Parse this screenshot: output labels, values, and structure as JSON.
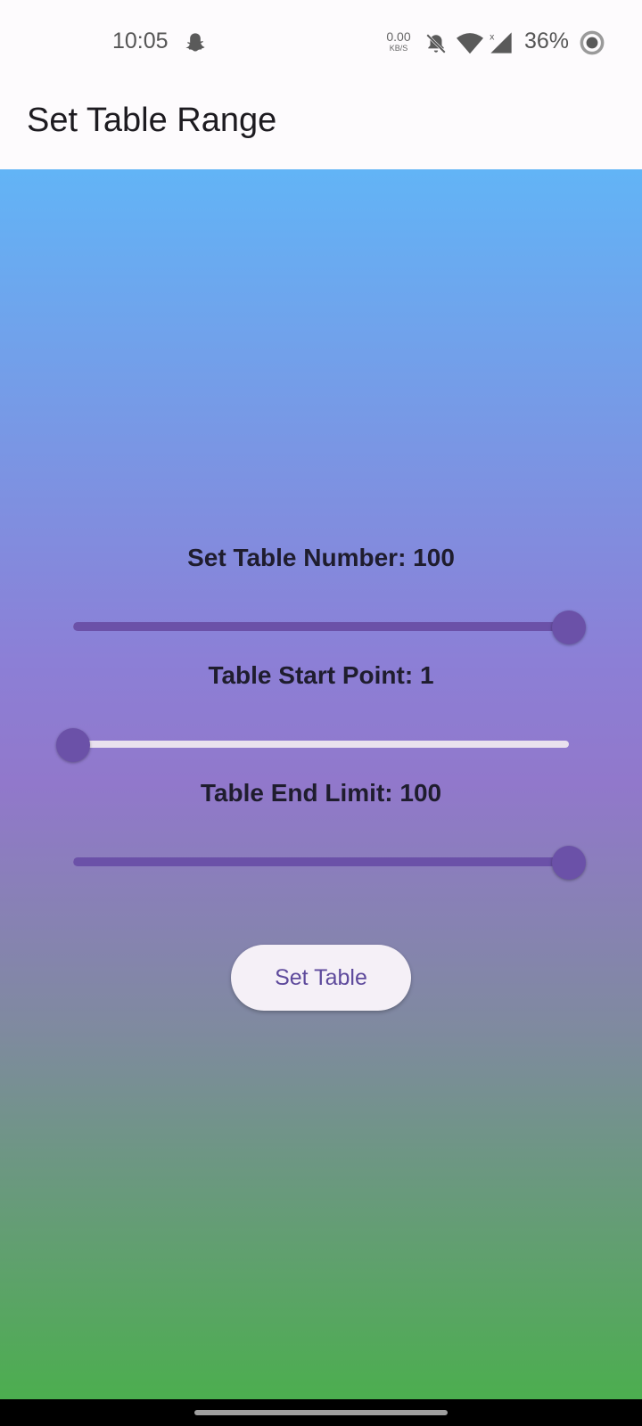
{
  "status_bar": {
    "time": "10:05",
    "net_speed_value": "0.00",
    "net_speed_unit": "KB/S",
    "battery": "36%",
    "icons": [
      "snapchat-icon",
      "bell-off-icon",
      "wifi-icon",
      "signal-icon",
      "battery-saver-icon"
    ]
  },
  "app_bar": {
    "title": "Set Table Range"
  },
  "sliders": [
    {
      "label": "Set Table Number: 100",
      "level": 1.0
    },
    {
      "label": "Table Start Point: 1",
      "level": 0.0
    },
    {
      "label": "Table End Limit: 100",
      "level": 1.0
    }
  ],
  "button": {
    "label": "Set Table"
  },
  "colors": {
    "accent": "#6b51a8",
    "gradient_top": "#62b4f6",
    "gradient_mid": "#9178cb",
    "gradient_bottom": "#4cae4f"
  }
}
